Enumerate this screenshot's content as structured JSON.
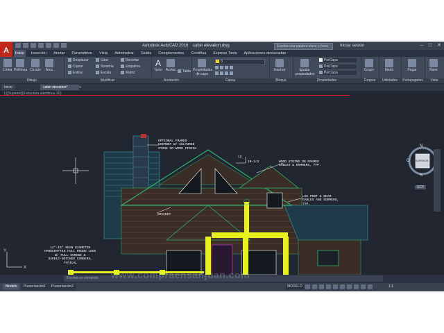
{
  "titlebar": {
    "app_title": "Autodesk AutoCAD 2016",
    "file_title": "cabin elevation.dwg",
    "search_placeholder": "Escriba una palabra clave o frase",
    "sign_in": "Iniciar sesión"
  },
  "ribbon_tabs": [
    "Inicio",
    "Inserción",
    "Anotar",
    "Paramétrico",
    "Vista",
    "Administrar",
    "Salida",
    "Complementos",
    "Contiñua",
    "Express Tools",
    "Aplicaciones destacadas"
  ],
  "ribbon_active_tab": "Inicio",
  "ribbon": {
    "dibujo": {
      "label": "Dibujo",
      "tools": [
        "Línea",
        "Polilínea",
        "Círculo",
        "Arco"
      ]
    },
    "modificar": {
      "label": "Modificar",
      "tools": [
        "Desplazar",
        "Girar",
        "Recortar",
        "Copiar",
        "Simetría",
        "Empalme",
        "Estirar",
        "Escala",
        "Matriz"
      ]
    },
    "anotacion": {
      "label": "Anotación",
      "tools": [
        "Texto",
        "Acotar",
        "Tabla"
      ]
    },
    "capas": {
      "label": "Capas",
      "big_tool": "Propiedades de capa",
      "current_layer": "0"
    },
    "bloque": {
      "label": "Bloque",
      "tools": [
        "Insertar"
      ]
    },
    "propiedades": {
      "label": "Propiedades",
      "tools": [
        "Igualar propiedades"
      ],
      "values": [
        "PorCapa",
        "PorCapa",
        "PorCapa"
      ]
    },
    "grupos": {
      "label": "Grupos",
      "tools": [
        "Grupo"
      ]
    },
    "utilidades": {
      "label": "Utilidades",
      "tools": [
        "Medir"
      ]
    },
    "portapapeles": {
      "label": "Portapapeles",
      "tools": [
        "Pegar"
      ]
    },
    "vista": {
      "label": "Vista",
      "tools": [
        "Base"
      ]
    }
  },
  "doc_tabs": {
    "start": "Inicio",
    "file": "cabin elevation*",
    "plus": "+"
  },
  "viewport_label": "[-][Superior][Estructura alámbrica 2D]",
  "annotations": {
    "chimney": "OPTIONAL FRAMED\nCHIMNEY W/ CULTURED\nSTONE OR WOOD FINISH",
    "siding": "WOOD SIDING ON FRAMED\nGABLES & DORMERS, TYP.",
    "pitch_rise": "12",
    "pitch_run": "10-1/2",
    "logpost": "LOG POST & BEAM\nGABLES AND DORMERS,\nTYP.",
    "cricket": "CRICKET",
    "logs": "12\"-16\" MEAN DIAMETER\nHANDCRAFTED FULL ROUND LOGS\nW/ FULL SCRIBE &\nSADDLE-NOTCHED CORNERS,\nTYPICAL"
  },
  "viewcube": {
    "north": "N",
    "south": "S",
    "east": "E",
    "west": "O",
    "face": "SUPERIOR",
    "wcs": "SCP"
  },
  "command_line": "Escriba un comando",
  "layout_tabs": [
    "Modelo",
    "Presentación1",
    "Presentación2"
  ],
  "status": {
    "model": "MODELO",
    "scale": "1:1"
  },
  "watermark": "www.compraensanjuan.com",
  "colors": {
    "app_bg": "#2b3342",
    "canvas_bg": "#212630",
    "highlight_yellow": "#e6f21a",
    "green_lines": "#2fb36a",
    "cyan_lines": "#3aa0b0",
    "red_marker": "#d02020"
  }
}
